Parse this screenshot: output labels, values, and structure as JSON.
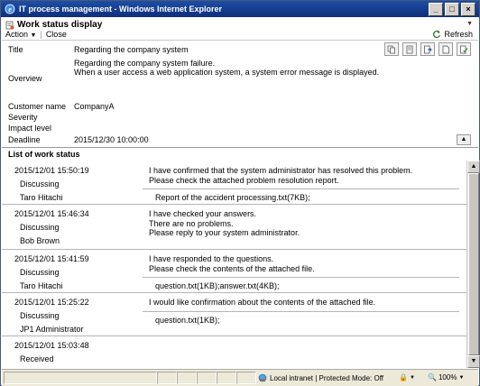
{
  "window": {
    "title": "IT process management - Windows Internet Explorer"
  },
  "header": {
    "page_title": "Work status display",
    "menu": {
      "action": "Action",
      "close": "Close"
    },
    "refresh": "Refresh"
  },
  "details": {
    "title_label": "Title",
    "title_value": "Regarding the company system",
    "overview_label": "Overview",
    "overview_line1": "Regarding the company system failure.",
    "overview_line2": "When a user access a web application system, a system error message is displayed.",
    "customer_label": "Customer name",
    "customer_value": "CompanyA",
    "severity_label": "Severity",
    "severity_value": "",
    "impact_label": "Impact level",
    "impact_value": "",
    "deadline_label": "Deadline",
    "deadline_value": "2015/12/30 10:00:00",
    "tool_icons": [
      "copy-doc-icon",
      "edit-doc-icon",
      "forward-doc-icon",
      "new-doc-icon",
      "approve-doc-icon"
    ]
  },
  "list": {
    "header": "List of work status",
    "entries": [
      {
        "timestamp": "2015/12/01 15:50:19",
        "status": "Discussing",
        "person": "Taro Hitachi",
        "message": [
          "I have confirmed that the system administrator has resolved this problem.",
          "Please check the attached problem resolution report."
        ],
        "attachment": "Report of the accident processing.txt(7KB);"
      },
      {
        "timestamp": "2015/12/01 15:46:34",
        "status": "Discussing",
        "person": "Bob Brown",
        "message": [
          "I have checked your answers.",
          "There are no problems.",
          "Please reply to your system administrator."
        ],
        "attachment": ""
      },
      {
        "timestamp": "2015/12/01 15:41:59",
        "status": "Discussing",
        "person": "Taro Hitachi",
        "message": [
          "I have responded to the questions.",
          "Please check the contents of the attached file."
        ],
        "attachment": "question.txt(1KB);answer.txt(4KB);"
      },
      {
        "timestamp": "2015/12/01 15:25:22",
        "status": "Discussing",
        "person": "JP1 Administrator",
        "message": [
          "I would like confirmation about the contents of the attached file."
        ],
        "attachment": "question.txt(1KB);"
      },
      {
        "timestamp": "2015/12/01 15:03:48",
        "status": "Received",
        "person": "",
        "message": [],
        "attachment": ""
      }
    ]
  },
  "statusbar": {
    "zone": "Local intranet | Protected Mode: Off",
    "zoom": "100%"
  }
}
